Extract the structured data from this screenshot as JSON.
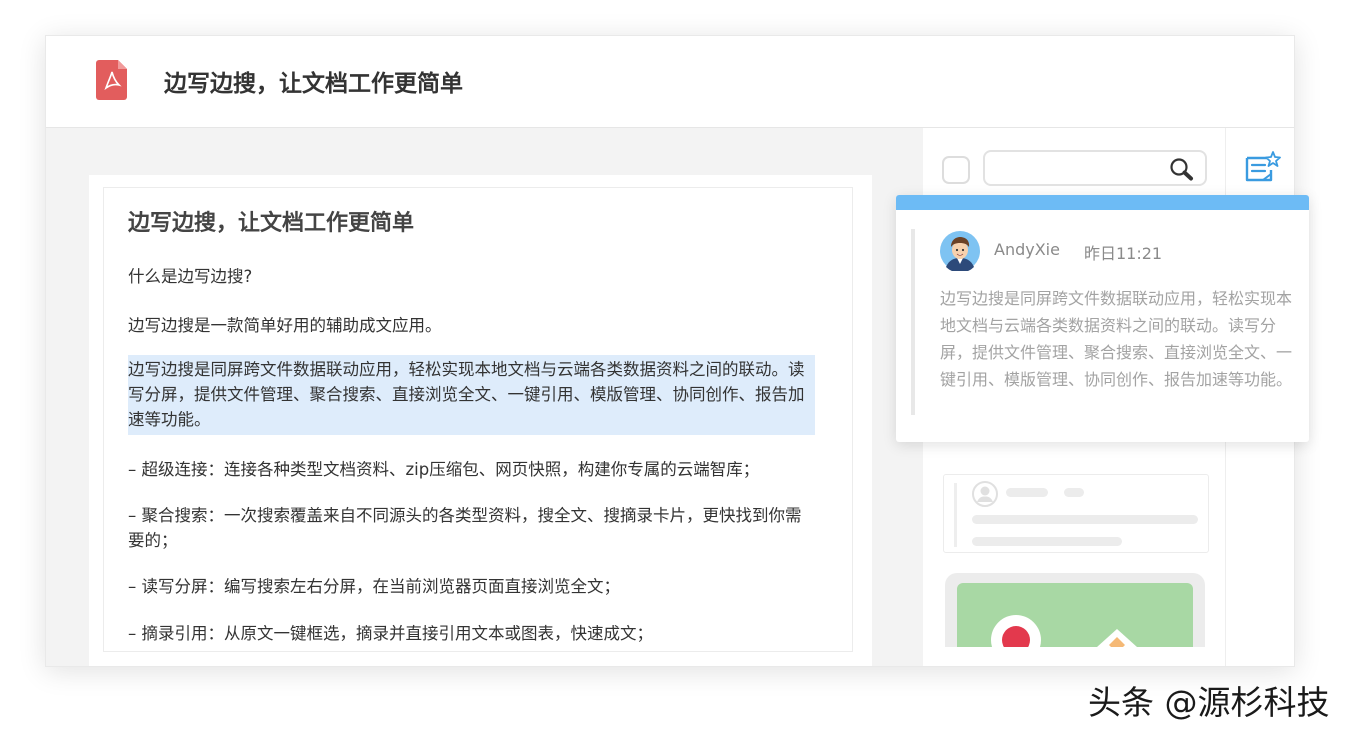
{
  "header": {
    "title": "边写边搜，让文档工作更简单",
    "file_icon": "pdf-file-icon"
  },
  "document": {
    "title": "边写边搜，让文档工作更简单",
    "paragraphs": [
      "什么是边写边搜?",
      "边写边搜是一款简单好用的辅助成文应用。",
      "边写边搜是同屏跨文件数据联动应用，轻松实现本地文档与云端各类数据资料之间的联动。读写分屏，提供文件管理、聚合搜索、直接浏览全文、一键引用、模版管理、协同创作、报告加速等功能。",
      "– 超级连接：连接各种类型文档资料、zip压缩包、网页快照，构建你专属的云端智库；",
      "– 聚合搜索：一次搜索覆盖来自不同源头的各类型资料，搜全文、搜摘录卡片，更快找到你需要的；",
      "– 读写分屏：编写搜索左右分屏，在当前浏览器页面直接浏览全文；",
      "– 摘录引用：从原文一键框选，摘录并直接引用文本或图表，快速成文；"
    ]
  },
  "sidebar": {
    "search_placeholder": "",
    "search_value": "",
    "search_icon": "search-icon",
    "note_icon": "note-star-icon"
  },
  "comment": {
    "username": "AndyXie",
    "timestamp": "昨日11:21",
    "text": "边写边搜是同屏跨文件数据联动应用，轻松实现本地文档与云端各类数据资料之间的联动。读写分屏，提供文件管理、聚合搜索、直接浏览全文、一键引用、模版管理、协同创作、报告加速等功能。",
    "accent_color": "#6dbbf5"
  },
  "highlight_color": "#deecfb",
  "watermark": "头条 @源杉科技"
}
